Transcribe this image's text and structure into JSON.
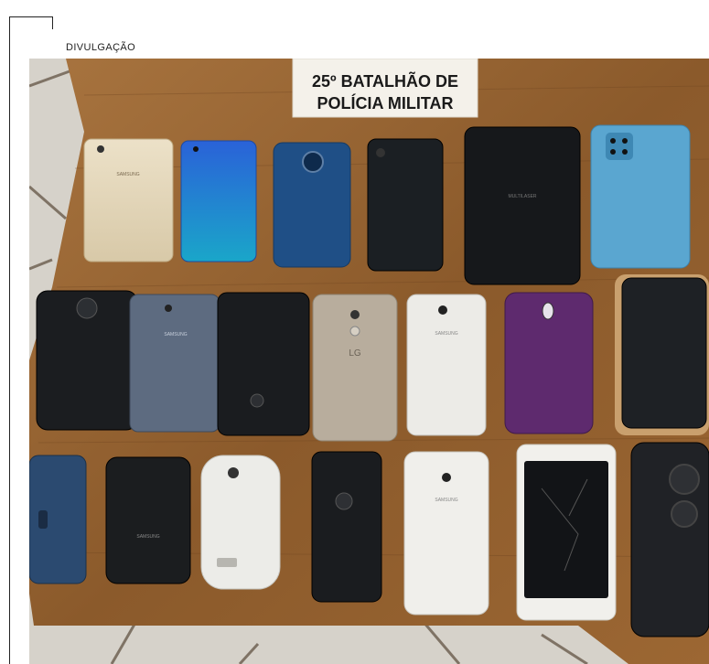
{
  "credit": "DIVULGAÇÃO",
  "sign": {
    "line1": "25º BATALHÃO DE",
    "line2": "POLÍCIA MILITAR"
  },
  "brands": {
    "samsung": "SAMSUNG",
    "multilaser": "MULTILASER",
    "lg": "LG"
  },
  "colors": {
    "table": "#8a5a2e",
    "floor": "#d9d6cf",
    "sign_bg": "#f4f1ea",
    "sign_text": "#1a1a1a"
  }
}
